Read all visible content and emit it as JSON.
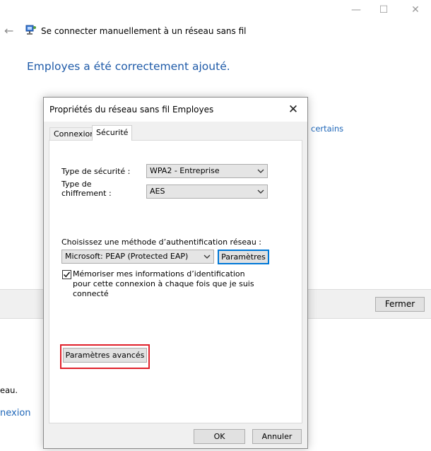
{
  "wizard": {
    "title": "Se connecter manuellement à un réseau sans fil",
    "success_message": "Employes a été correctement ajouté.",
    "link_partial": "certains",
    "close_label": "Fermer",
    "stub_text": "eau.",
    "stub_link": "nexion"
  },
  "dialog": {
    "title": "Propriétés du réseau sans fil Employes",
    "tabs": [
      {
        "label": "Connexion"
      },
      {
        "label": "Sécurité"
      }
    ],
    "security_type_label": "Type de sécurité :",
    "security_type_value": "WPA2 - Entreprise",
    "encryption_label_line1": "Type de",
    "encryption_label_line2": "chiffrement :",
    "encryption_value": "AES",
    "auth_method_label": "Choisissez une méthode d’authentification réseau :",
    "auth_method_value": "Microsoft: PEAP (Protected EAP)",
    "params_label": "Paramètres",
    "remember_label": "Mémoriser mes informations d’identification pour cette connexion à chaque fois que je suis connecté",
    "remember_checked": true,
    "advanced_label": "Paramètres avancés",
    "ok_label": "OK",
    "cancel_label": "Annuler"
  },
  "colors": {
    "accent": "#0078d7",
    "link": "#1e66b8",
    "highlight": "#e0202a"
  }
}
